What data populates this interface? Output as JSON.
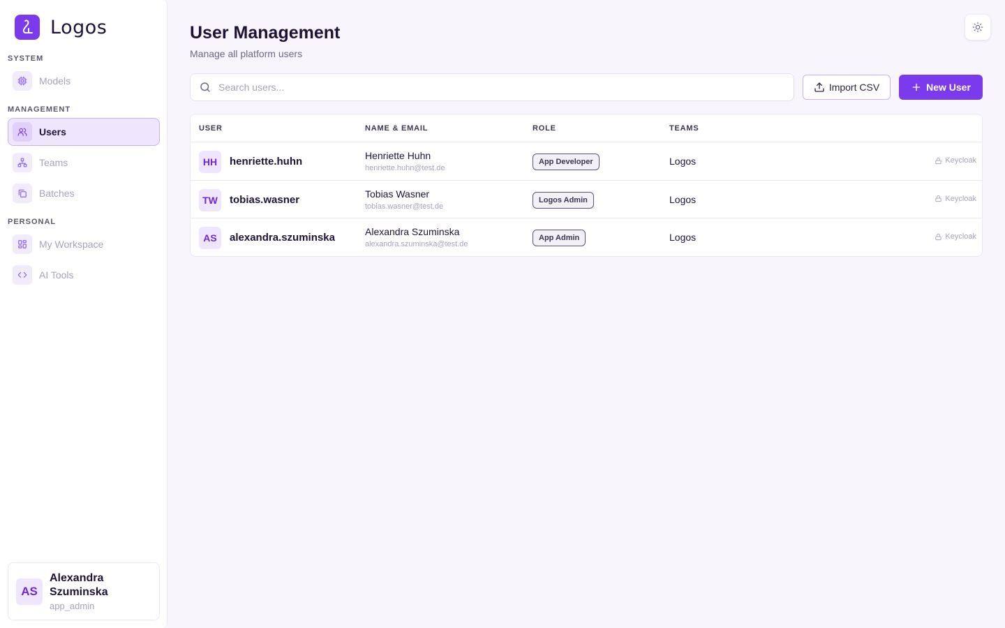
{
  "app": {
    "name": "Logos"
  },
  "sidebar": {
    "sections": [
      {
        "label": "SYSTEM"
      },
      {
        "label": "MANAGEMENT"
      },
      {
        "label": "PERSONAL"
      }
    ],
    "items": [
      {
        "label": "Models",
        "icon": "cpu-icon",
        "active": false
      },
      {
        "label": "Users",
        "icon": "users-icon",
        "active": true
      },
      {
        "label": "Teams",
        "icon": "network-icon",
        "active": false
      },
      {
        "label": "Batches",
        "icon": "copy-icon",
        "active": false
      },
      {
        "label": "My Workspace",
        "icon": "grid-icon",
        "active": false
      },
      {
        "label": "AI Tools",
        "icon": "code-icon",
        "active": false
      }
    ],
    "current_user": {
      "initials": "AS",
      "name": "Alexandra Szuminska",
      "role": "app_admin"
    }
  },
  "page": {
    "title": "User Management",
    "subtitle": "Manage all platform users"
  },
  "toolbar": {
    "search_placeholder": "Search users...",
    "import_label": "Import CSV",
    "new_label": "New User"
  },
  "table": {
    "headers": [
      "USER",
      "NAME & EMAIL",
      "ROLE",
      "TEAMS"
    ],
    "rows": [
      {
        "initials": "HH",
        "username": "henriette.huhn",
        "name": "Henriette Huhn",
        "email": "henriette.huhn@test.de",
        "role": "App Developer",
        "team": "Logos",
        "auth": "Keycloak"
      },
      {
        "initials": "TW",
        "username": "tobias.wasner",
        "name": "Tobias Wasner",
        "email": "tobias.wasner@test.de",
        "role": "Logos Admin",
        "team": "Logos",
        "auth": "Keycloak"
      },
      {
        "initials": "AS",
        "username": "alexandra.szuminska",
        "name": "Alexandra Szuminska",
        "email": "alexandra.szuminska@test.de",
        "role": "App Admin",
        "team": "Logos",
        "auth": "Keycloak"
      }
    ]
  },
  "colors": {
    "accent": "#7c3aed",
    "accent_light": "#efe6fd",
    "background": "#f8f5fd"
  }
}
